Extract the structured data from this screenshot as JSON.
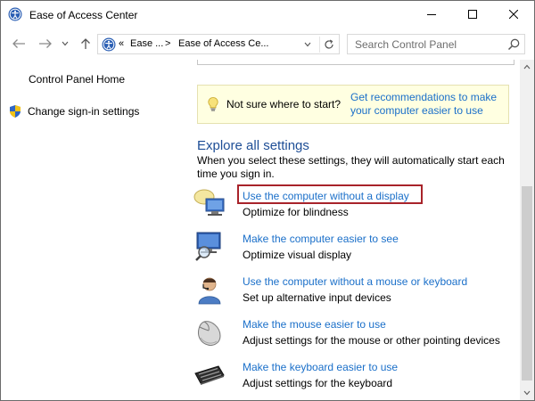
{
  "window": {
    "title": "Ease of Access Center",
    "controls": [
      "minimize-icon",
      "maximize-icon",
      "close-icon"
    ]
  },
  "navigation": {
    "back_icon": "arrow-left-icon",
    "forward_icon": "arrow-right-icon",
    "recent_icon": "chevron-down-icon",
    "up_icon": "arrow-up-icon",
    "address": {
      "overflow_chevron": "«",
      "crumbs": [
        "Ease ...",
        "Ease of Access Ce..."
      ],
      "separator": ">"
    },
    "search": {
      "placeholder": "Search Control Panel",
      "value": ""
    }
  },
  "sidebar": {
    "items": [
      {
        "label": "Control Panel Home"
      },
      {
        "label": "Change sign-in settings",
        "icon": "shield-icon"
      }
    ]
  },
  "main": {
    "tip": {
      "text": "Not sure where to start?",
      "link": "Get recommendations to make your computer easier to use",
      "icon": "lightbulb-icon"
    },
    "section": {
      "title": "Explore all settings",
      "description": "When you select these settings, they will automatically start each time you sign in."
    },
    "settings": [
      {
        "link": "Use the computer without a display",
        "description": "Optimize for blindness",
        "icon": "narrator-icon",
        "highlighted": true
      },
      {
        "link": "Make the computer easier to see",
        "description": "Optimize visual display",
        "icon": "magnifier-icon"
      },
      {
        "link": "Use the computer without a mouse or keyboard",
        "description": "Set up alternative input devices",
        "icon": "speech-user-icon"
      },
      {
        "link": "Make the mouse easier to use",
        "description": "Adjust settings for the mouse or other pointing devices",
        "icon": "mouse-icon"
      },
      {
        "link": "Make the keyboard easier to use",
        "description": "Adjust settings for the keyboard",
        "icon": "keyboard-icon"
      }
    ]
  },
  "colors": {
    "link": "#1a6fc9",
    "section_title": "#1e4e96",
    "tip_background": "#ffffe1",
    "highlight_border": "#a8232a"
  }
}
